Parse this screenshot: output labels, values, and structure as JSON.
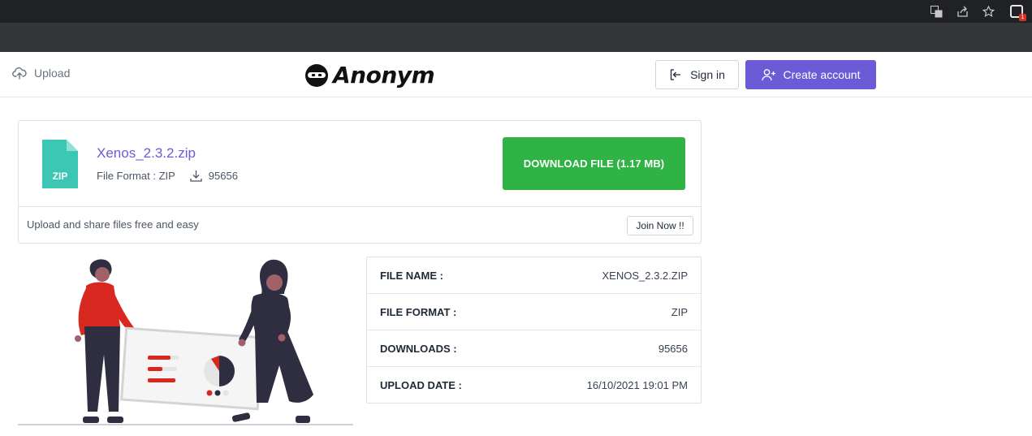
{
  "header": {
    "upload_label": "Upload",
    "logo_text": "Anonym",
    "signin_label": "Sign in",
    "create_account_label": "Create account"
  },
  "file": {
    "name": "Xenos_2.3.2.zip",
    "format_text": "File Format : ZIP",
    "downloads": "95656",
    "icon_label": "ZIP",
    "download_button": "DOWNLOAD FILE (1.17 MB)"
  },
  "promo": {
    "tagline": "Upload and share files free and easy",
    "join_button": "Join Now !!"
  },
  "details": [
    {
      "label": "FILE NAME :",
      "value": "XENOS_2.3.2.ZIP"
    },
    {
      "label": "FILE FORMAT :",
      "value": "ZIP"
    },
    {
      "label": "DOWNLOADS :",
      "value": "95656"
    },
    {
      "label": "UPLOAD DATE :",
      "value": "16/10/2021 19:01 PM"
    }
  ],
  "extension_badge": "1",
  "colors": {
    "accent": "#6b5bd6",
    "download_green": "#2fb344",
    "file_icon_teal": "#3cc6b4",
    "illustration_red": "#d8281f"
  }
}
